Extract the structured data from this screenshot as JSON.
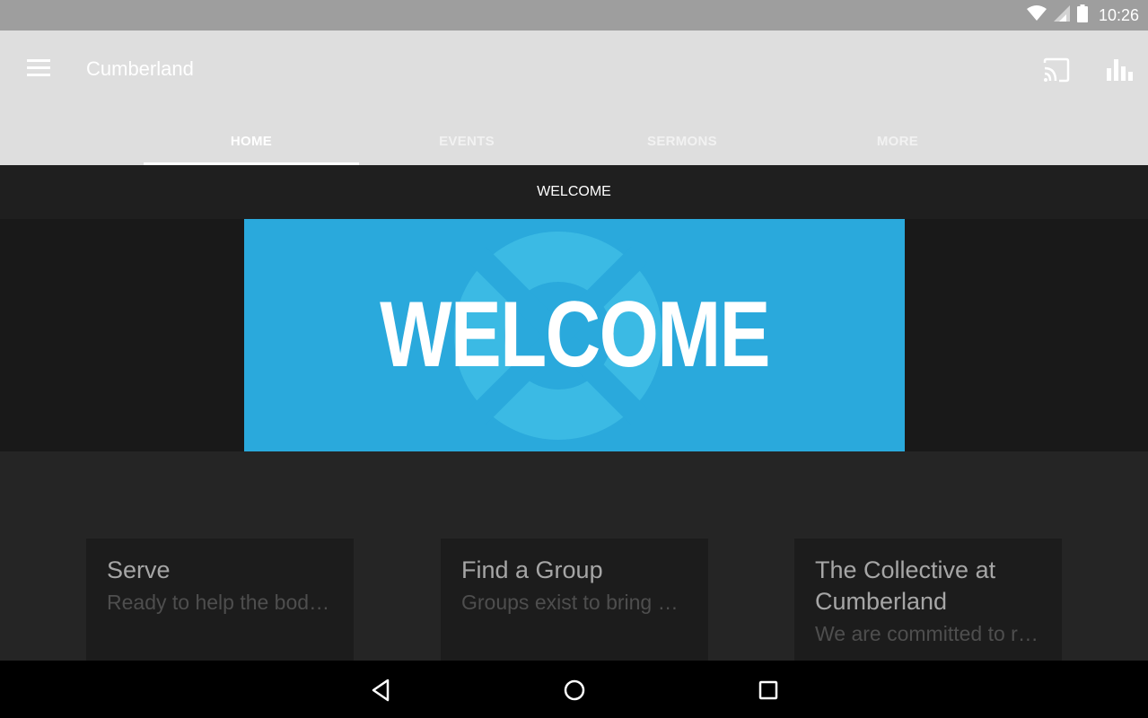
{
  "status_bar": {
    "time": "10:26",
    "icons": [
      "wifi-icon",
      "signal-icon",
      "battery-icon"
    ]
  },
  "app_bar": {
    "title": "Cumberland",
    "icons": [
      "menu-icon",
      "cast-icon",
      "stats-icon"
    ]
  },
  "tabs": [
    {
      "label": "HOME",
      "active": true
    },
    {
      "label": "EVENTS",
      "active": false
    },
    {
      "label": "SERMONS",
      "active": false
    },
    {
      "label": "MORE",
      "active": false
    }
  ],
  "section": {
    "header": "WELCOME"
  },
  "banner": {
    "text": "WELCOME",
    "color": "#2aa9dc"
  },
  "cards": [
    {
      "title": "Serve",
      "subtitle": "Ready to help the body of Christ"
    },
    {
      "title": "Find a Group",
      "subtitle": "Groups exist to bring people together"
    },
    {
      "title": "The Collective at Cumberland",
      "subtitle": "We are committed to reaching"
    }
  ],
  "nav_bar": {
    "icons": [
      "back-icon",
      "home-icon",
      "recents-icon"
    ]
  }
}
